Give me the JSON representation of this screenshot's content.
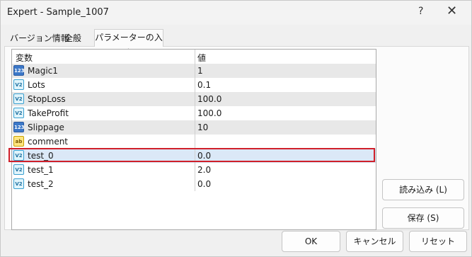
{
  "window": {
    "title": "Expert - Sample_1007",
    "help_glyph": "?",
    "close_glyph": "✕"
  },
  "tabs": [
    {
      "label": "バージョン情報"
    },
    {
      "label": "全般"
    },
    {
      "label": "パラメーターの入力",
      "selected": true
    }
  ],
  "grid": {
    "columns": [
      "変数",
      "値"
    ],
    "rows": [
      {
        "icon": "integer-icon",
        "icon_text": "123",
        "name": "Magic1",
        "value": "1"
      },
      {
        "icon": "double-icon",
        "icon_text": "V2",
        "name": "Lots",
        "value": "0.1"
      },
      {
        "icon": "double-icon",
        "icon_text": "V2",
        "name": "StopLoss",
        "value": "100.0"
      },
      {
        "icon": "double-icon",
        "icon_text": "V2",
        "name": "TakeProfit",
        "value": "100.0"
      },
      {
        "icon": "integer-icon",
        "icon_text": "123",
        "name": "Slippage",
        "value": "10"
      },
      {
        "icon": "string-icon",
        "icon_text": "ab",
        "name": "comment",
        "value": ""
      },
      {
        "icon": "double-icon",
        "icon_text": "V2",
        "name": "test_0",
        "value": "0.0",
        "highlighted": true
      },
      {
        "icon": "double-icon",
        "icon_text": "V2",
        "name": "test_1",
        "value": "2.0"
      },
      {
        "icon": "double-icon",
        "icon_text": "V2",
        "name": "test_2",
        "value": "0.0"
      }
    ]
  },
  "buttons": {
    "load": "読み込み (L)",
    "save": "保存 (S)",
    "ok": "OK",
    "cancel": "キャンセル",
    "reset": "リセット"
  },
  "colors": {
    "highlight_border": "#d0202a",
    "alt_row": "#e8e8e8",
    "selected_row": "#dbe8f7"
  }
}
